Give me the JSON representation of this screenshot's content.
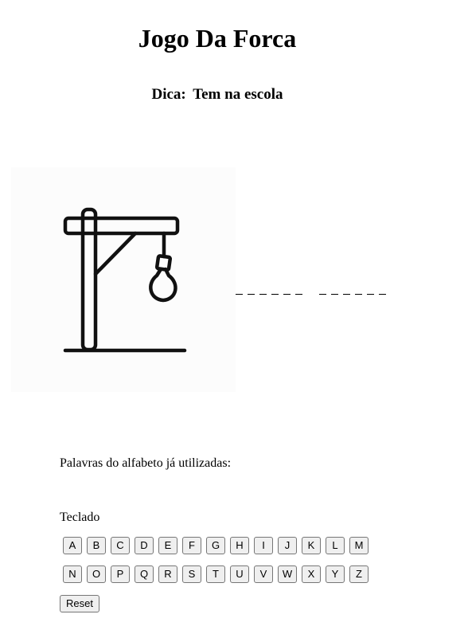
{
  "page": {
    "title": "Jogo Da Forca",
    "hint_label": "Dica:",
    "hint_text": "Tem na escola"
  },
  "gallows": {
    "icon": "gallows-icon",
    "errors": 0
  },
  "word": {
    "groups": [
      [
        "",
        "",
        "",
        "",
        "",
        ""
      ],
      [
        "",
        "",
        "",
        "",
        "",
        ""
      ]
    ]
  },
  "used_letters": {
    "label": "Palavras do alfabeto já utilizadas:",
    "value": ""
  },
  "keyboard": {
    "label": "Teclado",
    "row1": [
      "A",
      "B",
      "C",
      "D",
      "E",
      "F",
      "G",
      "H",
      "I",
      "J",
      "K",
      "L",
      "M"
    ],
    "row2": [
      "N",
      "O",
      "P",
      "Q",
      "R",
      "S",
      "T",
      "U",
      "V",
      "W",
      "X",
      "Y",
      "Z"
    ]
  },
  "reset": {
    "label": "Reset"
  }
}
